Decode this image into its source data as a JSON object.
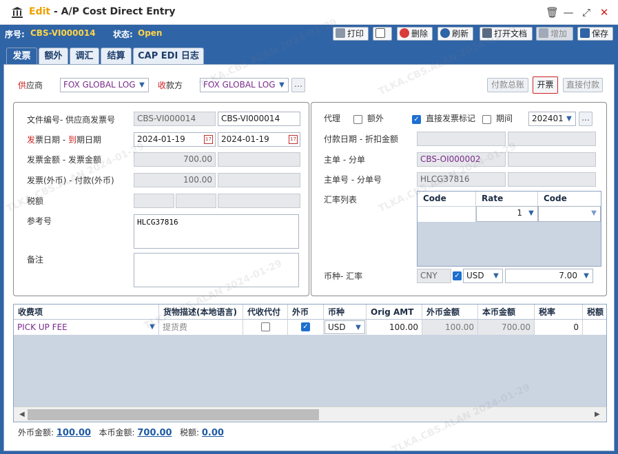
{
  "window": {
    "title_prefix": "Edit",
    "title_sep": " - ",
    "title": "A/P Cost Direct Entry",
    "close_glyph": "✕",
    "minimize_glyph": "—",
    "restore_glyph": "⤢",
    "delete_glyph": "🗑"
  },
  "info": {
    "seq_label": "序号:",
    "seq_value": "CBS-VI000014",
    "status_label": "状态:",
    "status_value": "Open"
  },
  "toolbar": {
    "print": "打印",
    "copy": "",
    "delete": "删除",
    "refresh": "刷新",
    "open_doc": "打开文档",
    "add": "增加",
    "save": "保存"
  },
  "tabs": [
    "发票",
    "额外",
    "调汇",
    "结算",
    "CAP EDI 日志"
  ],
  "header": {
    "supplier_label_red": "供",
    "supplier_label": "应商",
    "supplier_value": "FOX GLOBAL LOG",
    "payee_label_red": "收",
    "payee_label": "款方",
    "payee_value": "FOX GLOBAL LOG",
    "btn_pay_summary": "付款总账",
    "btn_invoice": "开票",
    "btn_direct_pay": "直接付款"
  },
  "left": {
    "docno_label": "文件编号- 供应商发票号",
    "docno_value": "CBS-VI000014",
    "vendor_inv_value": "CBS-VI000014",
    "date_label_red1": "发",
    "date_label_a": "票日期 - ",
    "date_label_red2": "到",
    "date_label_b": "期日期",
    "invoice_date": "2024-01-19",
    "due_date": "2024-01-19",
    "amount_label": "发票金额 - 发票金额",
    "amount_value": "700.00",
    "fx_label": "发票(外币) - 付款(外币)",
    "fx_value": "100.00",
    "tax_label": "税额",
    "ref_label": "参考号",
    "ref_value": "HLCG37816",
    "remark_label": "备注",
    "remark_value": ""
  },
  "right": {
    "agent_label": "代理",
    "extra_label": "额外",
    "direct_label": "直接发票标记",
    "period_label": "期间",
    "period_value": "202401",
    "paydate_label": "付款日期 - 折扣金额",
    "master_label": "主单 - 分单",
    "master_value": "CBS-OI000002",
    "masterno_label": "主单号 - 分单号",
    "masterno_value": "HLCG37816",
    "rate_list_label": "汇率列表",
    "rate_headers": [
      "Code",
      "Rate",
      "Code"
    ],
    "rate_row": [
      "",
      "1",
      ""
    ],
    "currency_label": "币种- 汇率",
    "base_currency": "CNY",
    "currency": "USD",
    "exchange_rate": "7.00"
  },
  "grid": {
    "headers": [
      "收费项",
      "货物描述(本地语言)",
      "代收代付",
      "外币",
      "币种",
      "Orig AMT",
      "外币金额",
      "本币金额",
      "税率",
      "税额"
    ],
    "row": {
      "charge": "PICK UP FEE",
      "desc": "提货费",
      "currency": "USD",
      "orig_amt": "100.00",
      "fx_amt": "100.00",
      "local_amt": "700.00",
      "tax_rate": "0"
    }
  },
  "footer": {
    "fx_total_label": "外币金额:",
    "fx_total": "100.00",
    "local_total_label": "本币金额:",
    "local_total": "700.00",
    "tax_total_label": "税额:",
    "tax_total": "0.00"
  },
  "watermark": "TLKA.CBS.ALAN 2024-01-29",
  "colors": {
    "brand_blue": "#2f64a6",
    "accent_yellow": "#ffd44a",
    "required_red": "#d02020",
    "link_purple": "#7a2a8a"
  }
}
